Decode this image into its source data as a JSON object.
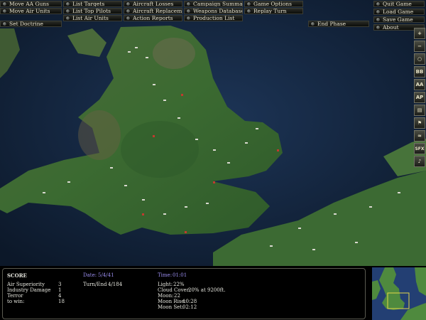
{
  "menu": {
    "row1": [
      "Move AA Guns",
      "List Targets",
      "Aircraft Losses",
      "Campaign Summary",
      "Game Options"
    ],
    "row2": [
      "Move Air Units",
      "List Top Pilots",
      "Aircraft Replacements",
      "Weapons Database",
      "Replay Turn"
    ],
    "row3": [
      "List Air Units",
      "Action Reports",
      "Production List"
    ],
    "set_doctrine": "Set Doctrine",
    "end_phase": "End Phase"
  },
  "side_menu": [
    "Quit Game",
    "Load Game",
    "Save Game",
    "About"
  ],
  "toolbar": [
    {
      "icon": "zoom-in-icon",
      "label": "+"
    },
    {
      "icon": "zoom-out-icon",
      "label": "−"
    },
    {
      "icon": "magnifier-icon",
      "label": "○"
    },
    {
      "icon": "bb-toggle-icon",
      "label": "BB"
    },
    {
      "icon": "aa-toggle-icon",
      "label": "AA"
    },
    {
      "icon": "ap-toggle-icon",
      "label": "AP"
    },
    {
      "icon": "report-icon",
      "label": "▤"
    },
    {
      "icon": "flag-icon",
      "label": "⚑"
    },
    {
      "icon": "weather-icon",
      "label": "≈"
    },
    {
      "icon": "sfx-icon",
      "label": "SFX"
    },
    {
      "icon": "music-icon",
      "label": "♪"
    }
  ],
  "score": {
    "title": "SCORE",
    "rows": [
      {
        "label": "Air Superiority",
        "value": "3"
      },
      {
        "label": "Industry Damage",
        "value": "1"
      },
      {
        "label": "Terror",
        "value": "4"
      },
      {
        "label": "to win:",
        "value": "18"
      }
    ]
  },
  "date": {
    "label": "Date:",
    "value": "5/4/41"
  },
  "turn": {
    "label": "Turn/End",
    "value": "4/184"
  },
  "time": {
    "label": "Time:",
    "value": "01:01"
  },
  "conditions": [
    {
      "label": "Light:",
      "value": "22%"
    },
    {
      "label": "Cloud Cover:",
      "value": "20% at 9200ft."
    },
    {
      "label": "Moon:",
      "value": "22"
    },
    {
      "label": "Moon Rise:",
      "value": "10:28"
    },
    {
      "label": "Moon Set:",
      "value": "02:12"
    }
  ],
  "colors": {
    "sea": "#13233d",
    "land": "#3f6b35",
    "panel_header": "#9b8ef0"
  }
}
